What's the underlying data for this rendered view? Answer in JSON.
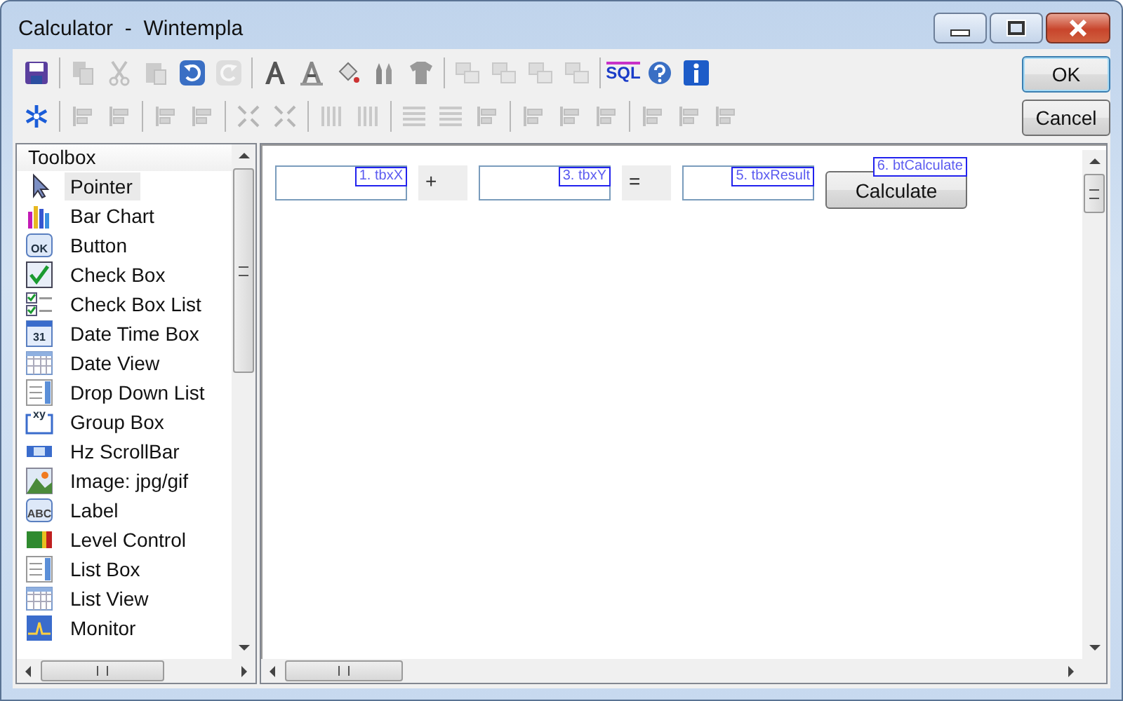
{
  "window": {
    "title": "Calculator  -  Wintempla"
  },
  "toolbar_rows": [
    [
      {
        "kind": "save",
        "disabled": false
      },
      {
        "kind": "sep"
      },
      {
        "kind": "copy",
        "disabled": true
      },
      {
        "kind": "cut",
        "disabled": true
      },
      {
        "kind": "paste",
        "disabled": true
      },
      {
        "kind": "undo",
        "disabled": false
      },
      {
        "kind": "redo",
        "disabled": true
      },
      {
        "kind": "sep"
      },
      {
        "kind": "font",
        "disabled": false
      },
      {
        "kind": "font-color",
        "disabled": false
      },
      {
        "kind": "fill",
        "disabled": false
      },
      {
        "kind": "pencils",
        "disabled": false
      },
      {
        "kind": "shirt",
        "disabled": false
      },
      {
        "kind": "sep"
      },
      {
        "kind": "layers",
        "disabled": true
      },
      {
        "kind": "layers",
        "disabled": true
      },
      {
        "kind": "layers",
        "disabled": true
      },
      {
        "kind": "layers",
        "disabled": true
      },
      {
        "kind": "sep"
      },
      {
        "kind": "sql",
        "label": "SQL",
        "disabled": false
      },
      {
        "kind": "help",
        "disabled": false
      },
      {
        "kind": "info",
        "disabled": false
      }
    ],
    [
      {
        "kind": "asterisk",
        "disabled": false
      },
      {
        "kind": "sep"
      },
      {
        "kind": "align",
        "disabled": true
      },
      {
        "kind": "align",
        "disabled": true
      },
      {
        "kind": "sep"
      },
      {
        "kind": "align",
        "disabled": true
      },
      {
        "kind": "align",
        "disabled": true
      },
      {
        "kind": "sep"
      },
      {
        "kind": "shrink",
        "disabled": true
      },
      {
        "kind": "grow",
        "disabled": true
      },
      {
        "kind": "sep"
      },
      {
        "kind": "columns",
        "disabled": true
      },
      {
        "kind": "columns",
        "disabled": true
      },
      {
        "kind": "sep"
      },
      {
        "kind": "rows",
        "disabled": true
      },
      {
        "kind": "rows",
        "disabled": true
      },
      {
        "kind": "align",
        "disabled": true
      },
      {
        "kind": "sep"
      },
      {
        "kind": "align",
        "disabled": true
      },
      {
        "kind": "align",
        "disabled": true
      },
      {
        "kind": "align",
        "disabled": true
      },
      {
        "kind": "sep"
      },
      {
        "kind": "align",
        "disabled": true
      },
      {
        "kind": "align",
        "disabled": true
      },
      {
        "kind": "align",
        "disabled": true
      }
    ]
  ],
  "buttons": [
    {
      "label": "OK",
      "default": true
    },
    {
      "label": "Cancel",
      "default": false
    }
  ],
  "toolbox": {
    "title": "Toolbox",
    "items": [
      {
        "label": "Pointer",
        "kind": "pointer",
        "selected": true
      },
      {
        "label": "Bar Chart",
        "kind": "bar-chart",
        "selected": false
      },
      {
        "label": "Button",
        "kind": "button",
        "icon_text": "OK",
        "selected": false
      },
      {
        "label": "Check Box",
        "kind": "check-box",
        "selected": false
      },
      {
        "label": "Check Box List",
        "kind": "check-list",
        "selected": false
      },
      {
        "label": "Date Time Box",
        "kind": "calendar",
        "icon_text": "31",
        "selected": false
      },
      {
        "label": "Date View",
        "kind": "grid",
        "selected": false
      },
      {
        "label": "Drop Down List",
        "kind": "dropdown",
        "selected": false
      },
      {
        "label": "Group Box",
        "kind": "group",
        "icon_text": "xy",
        "selected": false
      },
      {
        "label": "Hz ScrollBar",
        "kind": "hscroll",
        "selected": false
      },
      {
        "label": "Image: jpg/gif",
        "kind": "image",
        "selected": false
      },
      {
        "label": "Label",
        "kind": "label",
        "icon_text": "ABC",
        "selected": false
      },
      {
        "label": "Level Control",
        "kind": "level",
        "selected": false
      },
      {
        "label": "List Box",
        "kind": "list-box",
        "selected": false
      },
      {
        "label": "List View",
        "kind": "grid",
        "selected": false
      },
      {
        "label": "Monitor",
        "kind": "monitor",
        "selected": false
      }
    ]
  },
  "canvas": {
    "controls": [
      {
        "kind": "textbox",
        "tag": "1. tbxX"
      },
      {
        "kind": "label",
        "text": "+"
      },
      {
        "kind": "textbox",
        "tag": "3. tbxY"
      },
      {
        "kind": "label",
        "text": "="
      },
      {
        "kind": "textbox",
        "tag": "5. tbxResult"
      },
      {
        "kind": "button",
        "text": "Calculate",
        "tag": "6. btCalculate"
      }
    ]
  }
}
